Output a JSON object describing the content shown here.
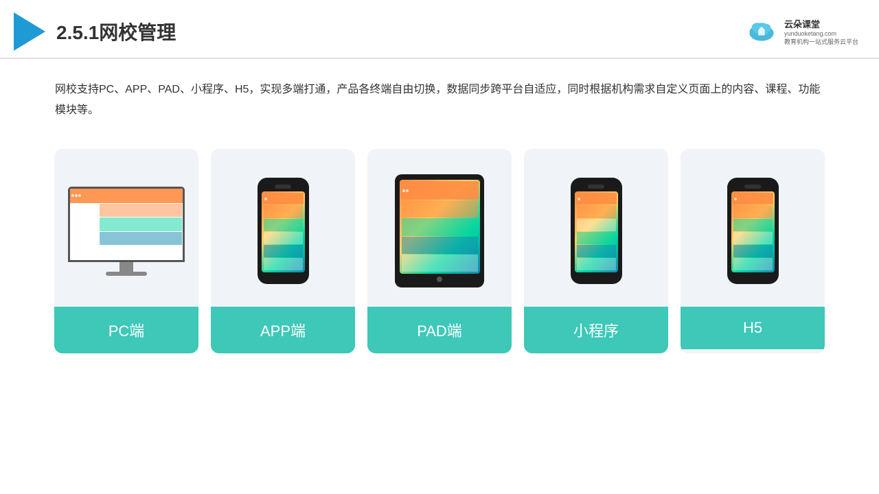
{
  "header": {
    "title": "2.5.1网校管理",
    "logo": {
      "name": "云朵课堂",
      "domain": "yunduoketang.com",
      "tagline": "教育机构一站\n式服务云平台"
    }
  },
  "description": {
    "text": "网校支持PC、APP、PAD、小程序、H5，实现多端打通，产品各终端自由切换，数据同步跨平台自适应，同时根据机构需求自定义页面上的内容、课程、功能模块等。"
  },
  "cards": [
    {
      "id": "pc",
      "label": "PC端"
    },
    {
      "id": "app",
      "label": "APP端"
    },
    {
      "id": "pad",
      "label": "PAD端"
    },
    {
      "id": "miniapp",
      "label": "小程序"
    },
    {
      "id": "h5",
      "label": "H5"
    }
  ]
}
